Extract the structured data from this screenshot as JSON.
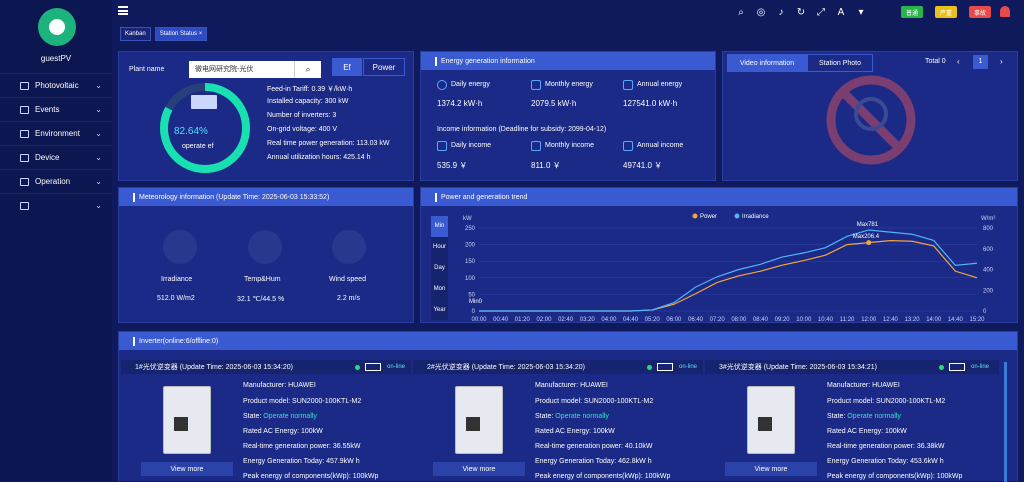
{
  "user": {
    "name": "guestPV"
  },
  "menu": [
    {
      "label": "Photovoltaic"
    },
    {
      "label": "Events"
    },
    {
      "label": "Environment"
    },
    {
      "label": "Device"
    },
    {
      "label": "Operation"
    },
    {
      "label": ""
    }
  ],
  "badges": [
    {
      "label": "普通",
      "color": "#29b34a"
    },
    {
      "label": "严重",
      "color": "#e8c11c"
    },
    {
      "label": "事故",
      "color": "#e84a4a"
    }
  ],
  "tabs": [
    {
      "label": "Kanban"
    },
    {
      "label": "Station Status ×"
    }
  ],
  "plant": {
    "label": "Plant name",
    "value": "微电网研究院-光伏",
    "ef_btn": "Ef",
    "power_btn": "Power",
    "gauge_value": "82.64%",
    "gauge_label": "operate ef",
    "info": [
      "Feed-in Tariff:  0.39 ￥/kW·h",
      "Installed capacity:  300 kW",
      "Number of inverters:  3",
      "On-grid voltage:  400 V",
      "Real time power generation:  113.03 kW",
      "Annual utilization hours:  425.14 h"
    ]
  },
  "energy": {
    "title": "Energy generation information",
    "daily_label": "Daily energy",
    "daily_value": "1374.2 kW·h",
    "monthly_label": "Monthly energy",
    "monthly_value": "2079.5 kW·h",
    "annual_label": "Annual energy",
    "annual_value": "127541.0 kW·h",
    "income_title": "Income information  (Deadline for subsidy:  2099-04-12)",
    "dinc_label": "Daily income",
    "dinc_value": "535.9  ￥",
    "minc_label": "Monthly income",
    "minc_value": "811.0  ￥",
    "ainc_label": "Annual income",
    "ainc_value": "49741.0  ￥"
  },
  "video": {
    "tab1": "Video information",
    "tab2": "Station Photo",
    "total": "Total 0",
    "page": "1"
  },
  "meteo": {
    "title": "Meteorology information (Update Time:  2025-06-03 15:33:52)",
    "irr_label": "Irradiance",
    "irr_value": "512.0 W/m2",
    "temp_label": "Temp&Hum",
    "temp_value": "32.1 ℃/44.5 %",
    "wind_label": "Wind speed",
    "wind_value": "2.2 m/s"
  },
  "trend": {
    "title": "Power and generation trend",
    "side": [
      "Min",
      "Hour",
      "Day",
      "Mon",
      "Year"
    ]
  },
  "chart_data": {
    "type": "line",
    "title": "",
    "ylabel": "kW",
    "y2label": "W/m²",
    "legend": [
      "Power",
      "Irradiance"
    ],
    "x": [
      "00:00",
      "00:40",
      "01:20",
      "02:00",
      "02:40",
      "03:20",
      "04:00",
      "04:40",
      "05:20",
      "06:00",
      "06:40",
      "07:20",
      "08:00",
      "08:40",
      "09:20",
      "10:00",
      "10:40",
      "11:20",
      "12:00",
      "12:40",
      "13:20",
      "14:00",
      "14:40",
      "15:20"
    ],
    "yticks": [
      "0",
      "50",
      "100",
      "150",
      "200",
      "250"
    ],
    "y2ticks": [
      "0",
      "200",
      "400",
      "600",
      "800"
    ],
    "ylim": [
      0,
      250
    ],
    "y2lim": [
      0,
      800
    ],
    "series": [
      {
        "name": "Power",
        "color": "#f5a53c",
        "values": [
          0,
          0,
          0,
          0,
          0,
          0,
          0,
          0,
          3,
          20,
          52,
          86,
          106,
          120,
          138,
          152,
          168,
          200,
          206,
          212,
          210,
          196,
          120,
          100
        ]
      },
      {
        "name": "Irradiance",
        "color": "#4fb3ff",
        "values": [
          0,
          0,
          0,
          0,
          0,
          0,
          0,
          0,
          10,
          80,
          230,
          330,
          400,
          450,
          520,
          560,
          610,
          720,
          781,
          760,
          740,
          680,
          440,
          460
        ]
      }
    ],
    "annotations": {
      "min": "Min0",
      "max_power": "Max206.4",
      "max_irr": "Max781"
    }
  },
  "inverters": {
    "title": "Inverter(online:6/offline:0)",
    "items": [
      {
        "name": "1#光伏逆变器 (Update Time:  2025-06-03 15:34:20)",
        "status": "on-line",
        "manu": "Manufacturer:  HUAWEI",
        "model": "Product model:  SUN2000-100KTL-M2",
        "state_l": "State:  ",
        "state_v": "Operate normally",
        "rated": "Rated AC Energy:  100kW",
        "rt": "Real-time generation power:  36.55kW",
        "today": "Energy Generation Today:  457.9kW h",
        "peak": "Peak energy of components(kWp):  100kWp",
        "more": "View more"
      },
      {
        "name": "2#光伏逆变器 (Update Time:  2025-06-03 15:34:20)",
        "status": "on-line",
        "manu": "Manufacturer:  HUAWEI",
        "model": "Product model:  SUN2000-100KTL-M2",
        "state_l": "State:  ",
        "state_v": "Operate normally",
        "rated": "Rated AC Energy:  100kW",
        "rt": "Real-time generation power:  40.10kW",
        "today": "Energy Generation Today:  462.8kW h",
        "peak": "Peak energy of components(kWp):  100kWp",
        "more": "View more"
      },
      {
        "name": "3#光伏逆变器 (Update Time:  2025-06-03 15:34:21)",
        "status": "on-line",
        "manu": "Manufacturer:  HUAWEI",
        "model": "Product model:  SUN2000-100KTL-M2",
        "state_l": "State:  ",
        "state_v": "Operate normally",
        "rated": "Rated AC Energy:  100kW",
        "rt": "Real-time generation power:  36.38kW",
        "today": "Energy Generation Today:  453.6kW h",
        "peak": "Peak energy of components(kWp):  100kWp",
        "more": "View more"
      }
    ]
  }
}
